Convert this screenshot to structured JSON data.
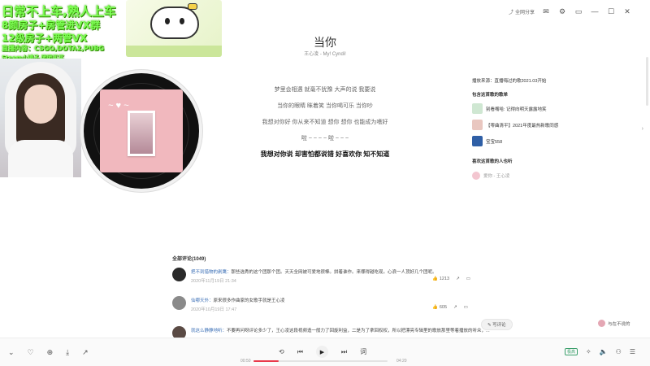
{
  "overlay": {
    "line1": "日常不上车,熟人上车",
    "line2": "8颜房子+房管进VX群",
    "line3": "12级房子+两管VX",
    "line4": "直播内容：CSGO,DOTA2,PUBG",
    "line5": "Steam小铺子,团团买买"
  },
  "window": {
    "share_label": "全网分享"
  },
  "song": {
    "title": "当你",
    "subtitle": "王心凌 - My! Cyndi!"
  },
  "lyrics": [
    {
      "text": "梦里会相遇 就毫不犹豫 大声的说  我要说",
      "active": false
    },
    {
      "text": "当你的眼睛  眯着笑  当你喝可乐  当你吵",
      "active": false
    },
    {
      "text": "我想对你好  你从来不知道  想你  想你  也能成为嗜好",
      "active": false
    },
    {
      "text": "啦 ~ ~ ~ ~ 啦 ~ ~ ~",
      "active": false
    },
    {
      "text": "我想对你说  却害怕都说错  好喜欢你  知不知道",
      "active": true
    }
  ],
  "right_panel": {
    "source": "播放来源：直播嗨过的歌2021.03开始",
    "playlists_heading": "包含这首歌的歌单",
    "playlists": [
      {
        "name": "别看嘴哈: 记得向明天露露地笑",
        "color": "#cfe7d2"
      },
      {
        "name": "【零曲清平】2021年度最热新歌同感",
        "color": "#e9c7c0"
      },
      {
        "name": "宝宝558",
        "color": "#2f5fa6"
      }
    ],
    "listeners_heading": "喜欢这首歌的人也听",
    "listener": "爱你 - 王心凌"
  },
  "comments": {
    "header": "全部评论(1049)",
    "items": [
      {
        "user": "把不到猎物的剥鹰：",
        "text": "那些选秀的这个团那个团。天天全网被可爱地很棒。拼着谁作。来哪得越吃现。心浪一人顶好几个团呢。",
        "time": "2020年11月19日 21:34",
        "likes": "1213",
        "avatar_color": "#2a2a2a"
      },
      {
        "user": "仙哪天外：",
        "text": "原来很多作曲家的女歌手就是王心凌",
        "time": "2020年10月19日 17:47",
        "likes": "605",
        "avatar_color": "#8a8a8a"
      },
      {
        "user": "就这么静静地听：",
        "text": "不要再问呀评论多少了，王心凌这段视频造一般力了回旋利益，二是为了拿回权权，所以把漂亮专辑里的歌放那里等着播放的听众，...",
        "time": "",
        "likes": "",
        "avatar_color": "#5a4a44"
      }
    ],
    "write_label": "写评论",
    "recommend_label": "与在不说的"
  },
  "player": {
    "time_current": "00:50",
    "time_total": "04:20",
    "progress": 0.19,
    "quality": "极高"
  },
  "colors": {
    "accent": "#e9394b",
    "link": "#3b6fb6",
    "overlay_green": "#7dff55"
  }
}
